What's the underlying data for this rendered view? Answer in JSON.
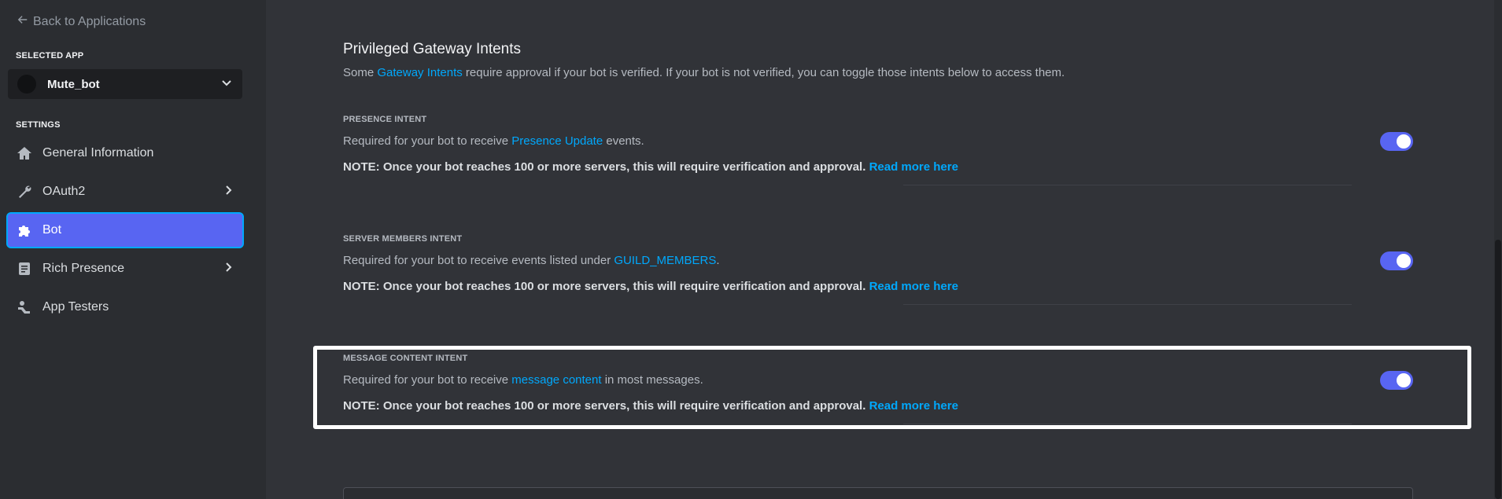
{
  "sidebar": {
    "back_label": "Back to Applications",
    "selected_app_label": "SELECTED APP",
    "app_name": "Mute_bot",
    "settings_label": "SETTINGS",
    "items": [
      {
        "label": "General Information",
        "icon": "home-icon"
      },
      {
        "label": "OAuth2",
        "icon": "wrench-icon",
        "has_children": true
      },
      {
        "label": "Bot",
        "icon": "puzzle-icon",
        "active": true
      },
      {
        "label": "Rich Presence",
        "icon": "document-icon",
        "has_children": true
      },
      {
        "label": "App Testers",
        "icon": "person-icon"
      }
    ]
  },
  "main": {
    "heading": "Privileged Gateway Intents",
    "sub_pre": "Some ",
    "sub_link": "Gateway Intents",
    "sub_post": " require approval if your bot is verified. If your bot is not verified, you can toggle those intents below to access them.",
    "intents": [
      {
        "title": "PRESENCE INTENT",
        "desc_pre": "Required for your bot to receive ",
        "desc_link": "Presence Update",
        "desc_post": " events.",
        "note": "NOTE: Once your bot reaches 100 or more servers, this will require verification and approval.",
        "note_link": "Read more here",
        "enabled": true
      },
      {
        "title": "SERVER MEMBERS INTENT",
        "desc_pre": "Required for your bot to receive events listed under ",
        "desc_link": "GUILD_MEMBERS",
        "desc_post": ".",
        "note": "NOTE: Once your bot reaches 100 or more servers, this will require verification and approval.",
        "note_link": "Read more here",
        "enabled": true
      },
      {
        "title": "MESSAGE CONTENT INTENT",
        "desc_pre": "Required for your bot to receive ",
        "desc_link": "message content",
        "desc_post": " in most messages.",
        "note": "NOTE: Once your bot reaches 100 or more servers, this will require verification and approval.",
        "note_link": "Read more here",
        "enabled": true
      }
    ]
  },
  "colors": {
    "accent": "#5865f2",
    "link": "#00a8fc",
    "background": "#313338",
    "sidebar": "#2b2d31"
  }
}
